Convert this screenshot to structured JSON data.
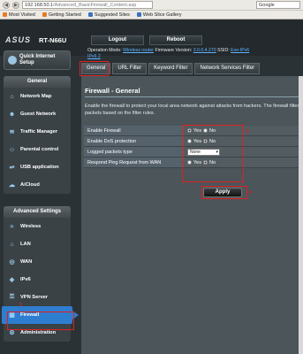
{
  "browser": {
    "url_host": "192.168.50.1",
    "url_path": "/Advanced_BasicFirewall_Content.asp",
    "search_engine": "Google",
    "bookmarks": [
      "Most Visited",
      "Getting Started",
      "Suggested Sites",
      "Web Slice Gallery"
    ]
  },
  "header": {
    "logo": "ASUS",
    "model": "RT-N66U",
    "logout": "Logout",
    "reboot": "Reboot",
    "op_mode_label": "Operation Mode:",
    "op_mode": "Wireless router",
    "firmware_label": "Firmware Version:",
    "firmware": "3.0.0.4.270",
    "ssid_label": "SSID:",
    "ssid": "Eve-IPv6",
    "ssid2": "IPv6 2"
  },
  "sidebar": {
    "quick_setup": "Quick Internet Setup",
    "general_title": "General",
    "general_items": [
      {
        "label": "Network Map",
        "icon": "network-map-icon"
      },
      {
        "label": "Guest Network",
        "icon": "guest-network-icon"
      },
      {
        "label": "Traffic Manager",
        "icon": "traffic-manager-icon"
      },
      {
        "label": "Parental control",
        "icon": "parental-control-icon"
      },
      {
        "label": "USB application",
        "icon": "usb-icon"
      },
      {
        "label": "AiCloud",
        "icon": "cloud-icon"
      }
    ],
    "advanced_title": "Advanced Settings",
    "advanced_items": [
      {
        "label": "Wireless",
        "icon": "wireless-icon"
      },
      {
        "label": "LAN",
        "icon": "lan-icon"
      },
      {
        "label": "WAN",
        "icon": "wan-icon"
      },
      {
        "label": "IPv6",
        "icon": "ipv6-icon"
      },
      {
        "label": "VPN Server",
        "icon": "vpn-icon"
      },
      {
        "label": "Firewall",
        "icon": "firewall-icon"
      },
      {
        "label": "Administration",
        "icon": "administration-icon"
      }
    ]
  },
  "tabs": [
    "General",
    "URL Filter",
    "Keyword Filter",
    "Network Services Filter"
  ],
  "content": {
    "title": "Firewall - General",
    "description": "Enable the firewall to protect your local area network against attacks from hackers. The firewall filters packets based on the filter rules.",
    "rows": [
      {
        "label": "Enable Firewall",
        "type": "radio",
        "yes": "Yes",
        "no": "No",
        "selected": "yes"
      },
      {
        "label": "Enable DoS protection",
        "type": "radio",
        "yes": "Yes",
        "no": "No",
        "selected": "no"
      },
      {
        "label": "Logged packets type",
        "type": "select",
        "value": "None"
      },
      {
        "label": "Respond Ping Request from WAN",
        "type": "radio",
        "yes": "Yes",
        "no": "No",
        "selected": "no"
      }
    ],
    "apply": "Apply"
  },
  "annotations": [
    "1",
    "2",
    "3",
    "4"
  ],
  "colors": {
    "highlight": "#e02020",
    "active": "#2e7ed0"
  }
}
